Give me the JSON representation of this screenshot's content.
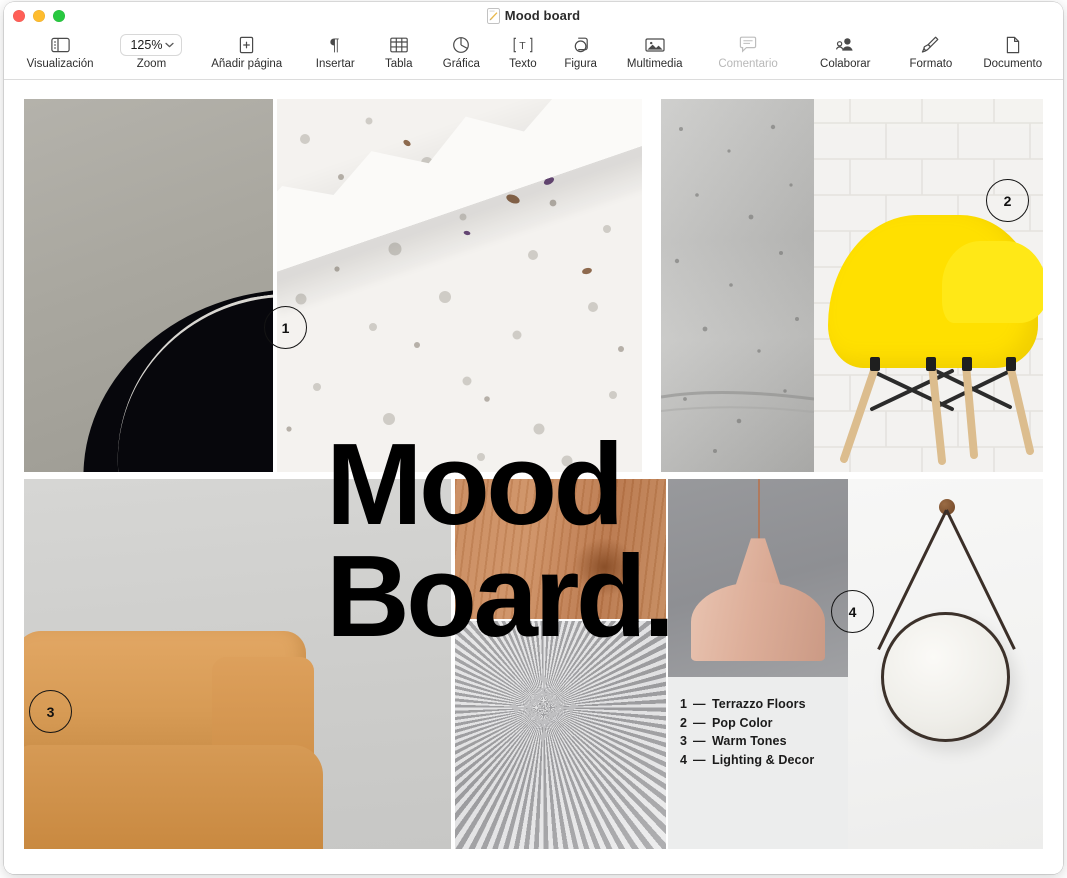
{
  "window": {
    "title": "Mood board",
    "doc_icon": "pages-document-icon",
    "traffic_lights": [
      {
        "name": "close-button",
        "color": "#ff5f57"
      },
      {
        "name": "minimize-button",
        "color": "#febc2e"
      },
      {
        "name": "maximize-button",
        "color": "#28c840"
      }
    ]
  },
  "toolbar": {
    "items": [
      {
        "name": "view",
        "label": "Visualización",
        "icon": "sidebar-icon",
        "disabled": false
      },
      {
        "name": "zoom",
        "label": "Zoom",
        "icon": "chevron-down-icon",
        "value": "125%",
        "disabled": false
      },
      {
        "name": "add-page",
        "label": "Añadir página",
        "icon": "add-page-icon",
        "disabled": false
      },
      {
        "name": "insert",
        "label": "Insertar",
        "icon": "pilcrow-icon",
        "disabled": false
      },
      {
        "name": "table",
        "label": "Tabla",
        "icon": "table-icon",
        "disabled": false
      },
      {
        "name": "chart",
        "label": "Gráfica",
        "icon": "pie-chart-icon",
        "disabled": false
      },
      {
        "name": "text",
        "label": "Texto",
        "icon": "text-box-icon",
        "disabled": false
      },
      {
        "name": "shape",
        "label": "Figura",
        "icon": "shape-icon",
        "disabled": false
      },
      {
        "name": "media",
        "label": "Multimedia",
        "icon": "photo-icon",
        "disabled": false
      },
      {
        "name": "comment",
        "label": "Comentario",
        "icon": "comment-bubble-icon",
        "disabled": true
      },
      {
        "name": "collaborate",
        "label": "Colaborar",
        "icon": "collaborate-person-icon",
        "disabled": false
      },
      {
        "name": "format",
        "label": "Formato",
        "icon": "paintbrush-icon",
        "disabled": false
      },
      {
        "name": "document",
        "label": "Documento",
        "icon": "document-page-icon",
        "disabled": false
      }
    ]
  },
  "document": {
    "headline": "Mood\nBoard.",
    "legend": [
      {
        "number": "1",
        "dash": "—",
        "text": "Terrazzo Floors"
      },
      {
        "number": "2",
        "dash": "—",
        "text": "Pop Color"
      },
      {
        "number": "3",
        "dash": "—",
        "text": "Warm Tones"
      },
      {
        "number": "4",
        "dash": "—",
        "text": "Lighting & Decor"
      }
    ],
    "badges": [
      {
        "id": "badge-1",
        "label": "1"
      },
      {
        "id": "badge-2",
        "label": "2"
      },
      {
        "id": "badge-3",
        "label": "3"
      },
      {
        "id": "badge-4",
        "label": "4"
      }
    ],
    "images": [
      {
        "name": "image-dark-leather-chair",
        "alt": "Dark leather chair against taupe wall"
      },
      {
        "name": "image-terrazzo-slab",
        "alt": "White terrazzo stone slab"
      },
      {
        "name": "image-concrete-wall",
        "alt": "Grey concrete wall texture"
      },
      {
        "name": "image-yellow-chair",
        "alt": "Yellow Eames style chair on white brick"
      },
      {
        "name": "image-tan-sofa",
        "alt": "Tan leather sofa against plaster wall"
      },
      {
        "name": "image-wood-grain",
        "alt": "Warm wood grain texture"
      },
      {
        "name": "image-grey-fur-rug",
        "alt": "Grey shag fur rug texture"
      },
      {
        "name": "image-pendant-lamp",
        "alt": "Blush pendant lamp on grey wall"
      },
      {
        "name": "image-round-mirror",
        "alt": "Round strap mirror on white wall"
      }
    ]
  },
  "colors": {
    "accent_yellow": "#ffe000",
    "tan_sofa": "#d79b55",
    "wood": "#c98a5d",
    "legend_panel": "#eceded",
    "headline": "#000000"
  }
}
